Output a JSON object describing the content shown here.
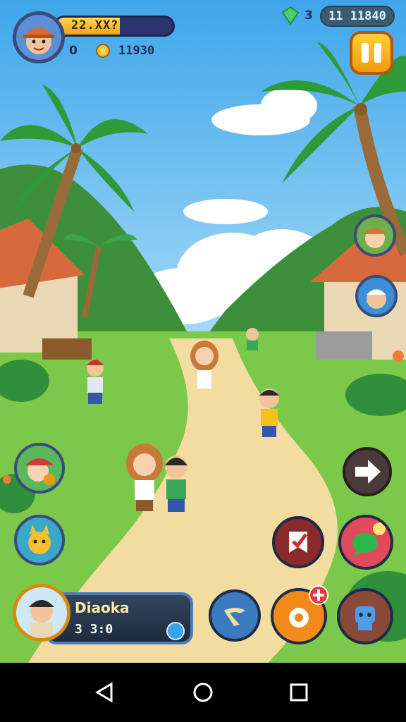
{
  "hud": {
    "xp_text": "22.XX?",
    "xp_progress": 0.55,
    "level": "0",
    "coins": "11930",
    "gem_count": "3",
    "currency": "11 11840",
    "pause_icon": "pause-icon"
  },
  "profile": {
    "name": "Diaoka",
    "score": "3 3:0",
    "badge_icon": "chevron-down-icon"
  },
  "actions": {
    "map_icon": "map-icon",
    "chat_icon": "chat-icon",
    "next_icon": "arrow-right-icon",
    "boomerang_icon": "boomerang-icon",
    "gear_icon": "gear-icon",
    "robot_icon": "robot-icon"
  },
  "colors": {
    "sky": "#58b8ef",
    "grass": "#7cc84a",
    "path": "#f2dca0",
    "accent": "#f2a418"
  },
  "nav": {
    "back_icon": "back-icon",
    "home_icon": "home-icon",
    "recents_icon": "recents-icon"
  }
}
